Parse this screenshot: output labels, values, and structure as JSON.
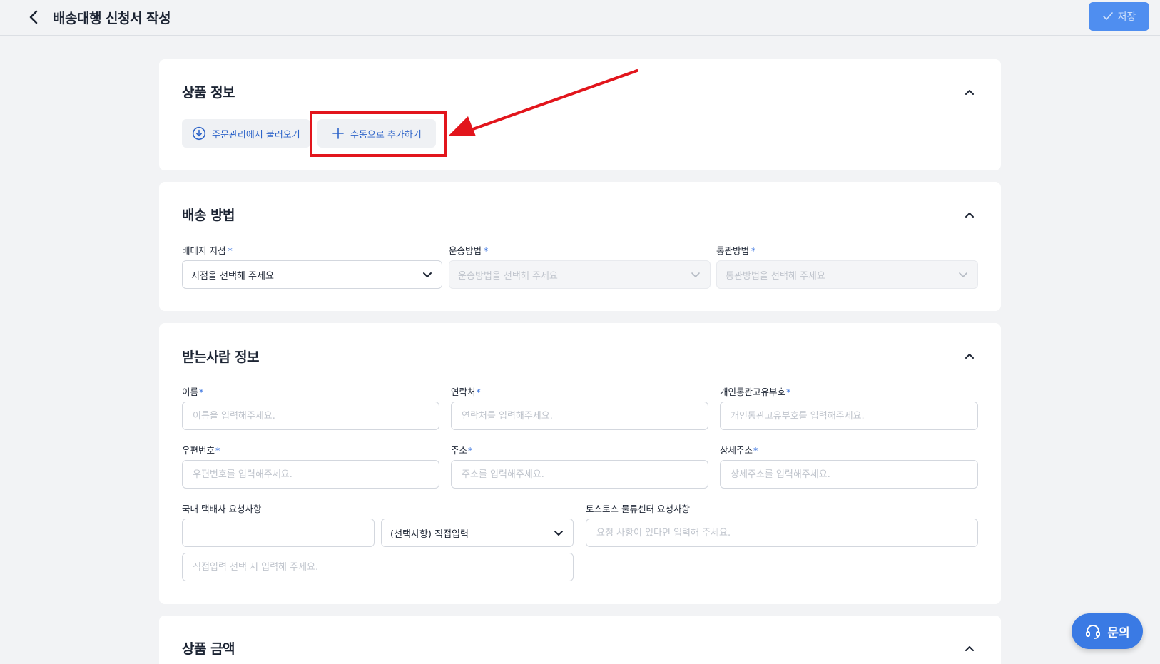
{
  "header": {
    "title": "배송대행 신청서 작성",
    "save_label": "저장"
  },
  "product_info": {
    "title": "상품 정보",
    "import_button": "주문관리에서 불러오기",
    "manual_add_button": "수동으로 추가하기"
  },
  "shipping_method": {
    "title": "배송 방법",
    "branch_label": "배대지 지점",
    "branch_placeholder": "지점을 선택해 주세요",
    "transport_label": "운송방법",
    "transport_placeholder": "운송방법을 선택해 주세요",
    "customs_label": "통관방법",
    "customs_placeholder": "통관방법을 선택해 주세요"
  },
  "recipient": {
    "title": "받는사람 정보",
    "name_label": "이름",
    "name_placeholder": "이름을 입력해주세요.",
    "phone_label": "연락처",
    "phone_placeholder": "연락처를 입력해주세요.",
    "customs_code_label": "개인통관고유부호",
    "customs_code_placeholder": "개인통관고유부호를 입력해주세요.",
    "zip_label": "우편번호",
    "zip_placeholder": "우편번호를 입력해주세요.",
    "address_label": "주소",
    "address_placeholder": "주소를 입력해주세요.",
    "detail_address_label": "상세주소",
    "detail_address_placeholder": "상세주소를 입력해주세요.",
    "courier_request_label": "국내 택배사 요청사항",
    "courier_request_select": "(선택사항) 직접입력",
    "courier_request_direct_placeholder": "직접입력 선택 시 입력해 주세요.",
    "center_request_label": "토스토스 물류센터 요청사항",
    "center_request_placeholder": "요청 사항이 있다면 입력해 주세요."
  },
  "product_amount": {
    "title": "상품 금액"
  },
  "required_mark": "*",
  "inquiry_label": "문의",
  "colors": {
    "accent": "#3a7ae4",
    "annotation": "#e2151c",
    "background": "#f2f3f5"
  }
}
